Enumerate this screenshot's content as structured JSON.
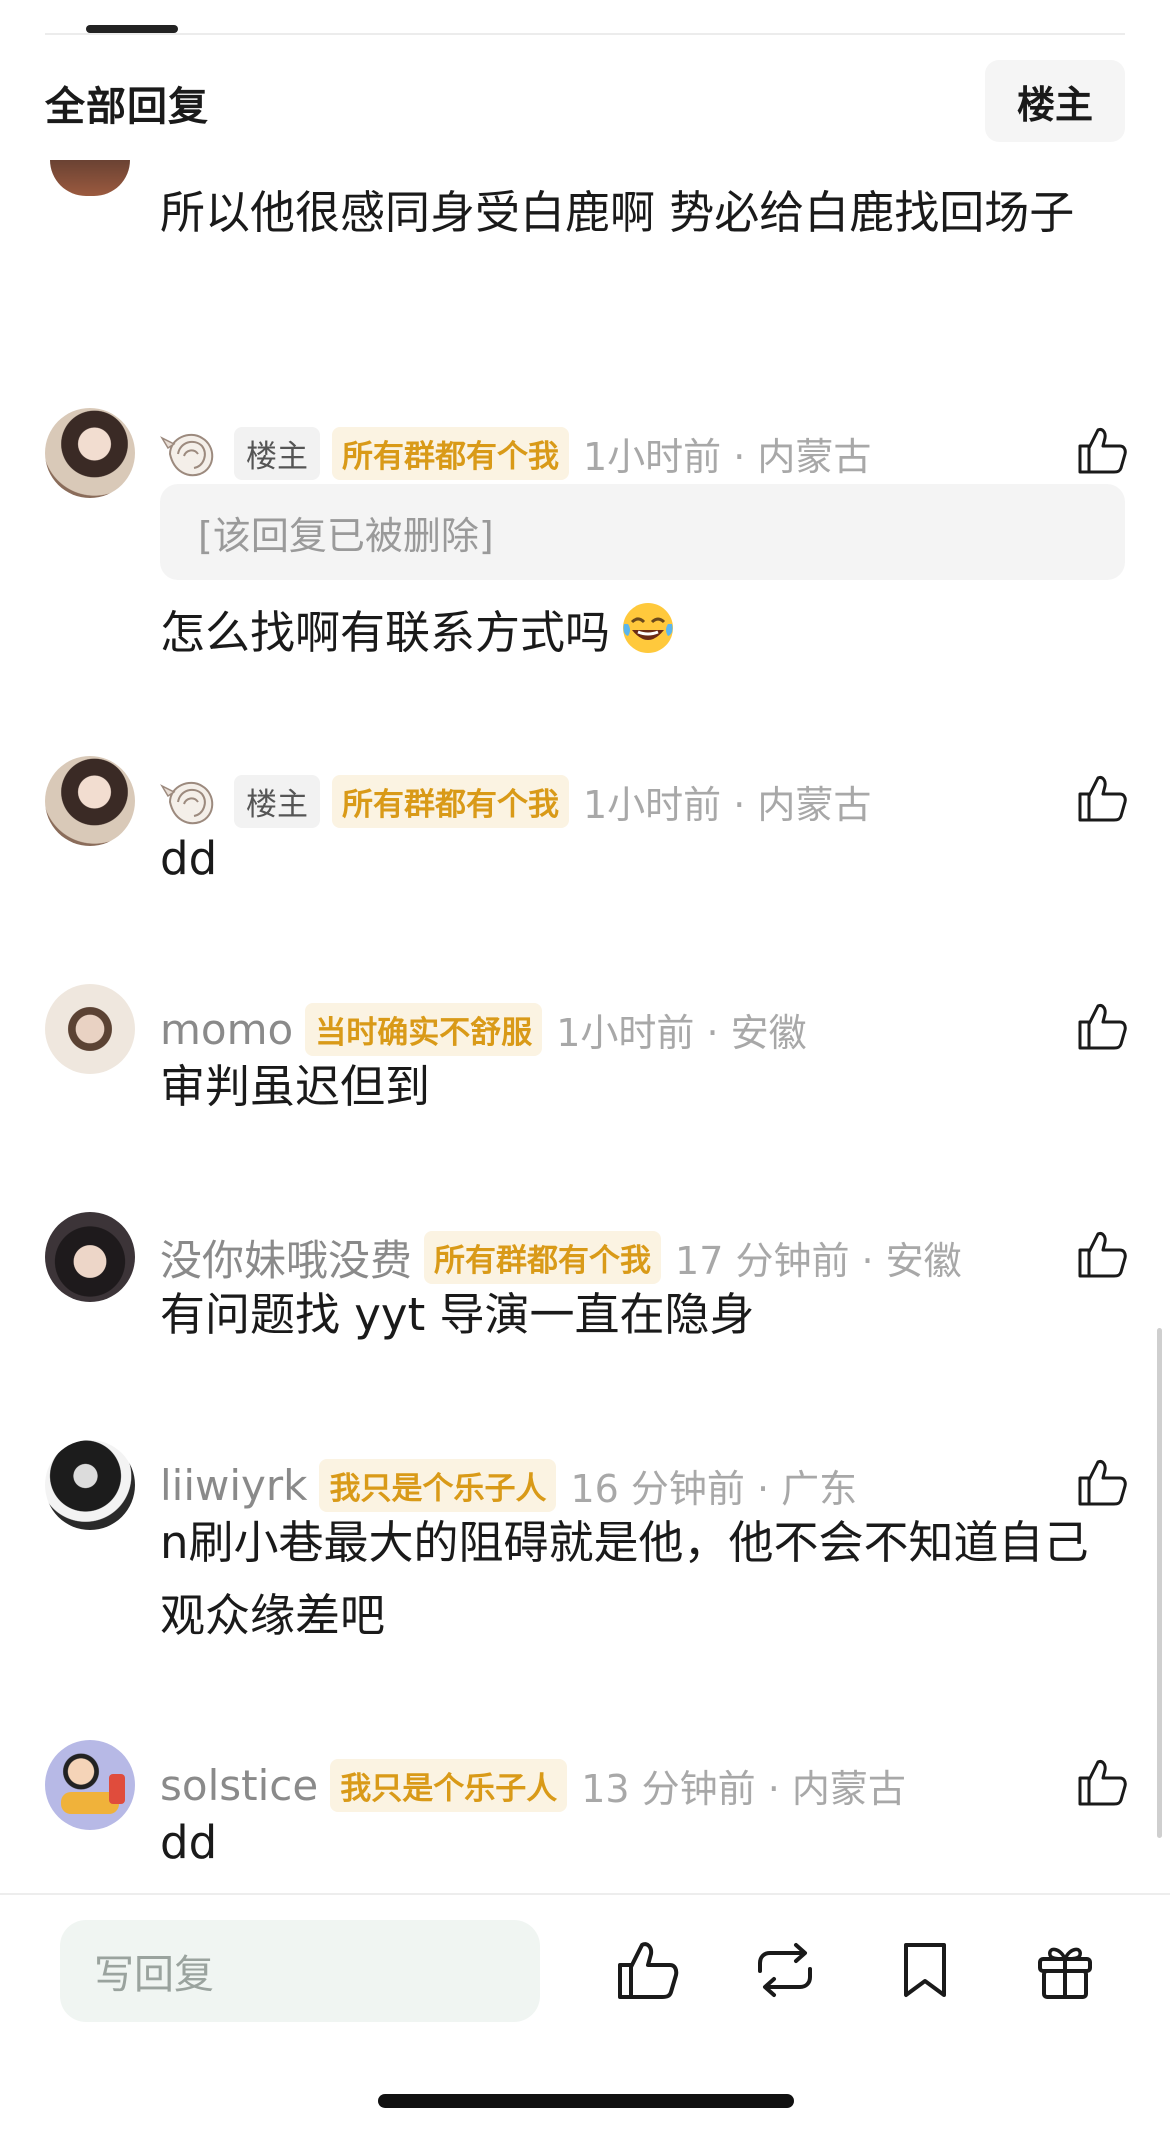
{
  "header": {
    "title": "全部回复",
    "poster_button": "楼主"
  },
  "top_comment_text": "所以他很感同身受白鹿啊 势必给白鹿找回场子",
  "comments": [
    {
      "username": "",
      "poster_tag": "楼主",
      "group_tag": "所有群都有个我",
      "time": "1小时前 · 内蒙古",
      "deleted_reply": "[该回复已被删除]",
      "text": "怎么找啊有联系方式吗"
    },
    {
      "username": "",
      "poster_tag": "楼主",
      "group_tag": "所有群都有个我",
      "time": "1小时前 · 内蒙古",
      "text": "dd"
    },
    {
      "username": "momo",
      "group_tag": "当时确实不舒服",
      "time": "1小时前 · 安徽",
      "text": "审判虽迟但到"
    },
    {
      "username": "没你妹哦没费",
      "group_tag": "所有群都有个我",
      "time": "17 分钟前 · 安徽",
      "text": "有问题找 yyt 导演一直在隐身"
    },
    {
      "username": "liiwiyrk",
      "group_tag": "我只是个乐子人",
      "time": "16 分钟前 · 广东",
      "text": "n刷小巷最大的阻碍就是他，他不会不知道自己观众缘差吧"
    },
    {
      "username": "solstice",
      "group_tag": "我只是个乐子人",
      "time": "13 分钟前 · 内蒙古",
      "text": "dd"
    }
  ],
  "bottom_bar": {
    "reply_placeholder": "写回复"
  },
  "icons": [
    "thumbs-up-icon",
    "shell-icon",
    "laugh-cry-emoji-icon",
    "repost-icon",
    "bookmark-icon",
    "gift-icon"
  ],
  "colors": {
    "group_tag_text": "#d99a18",
    "group_tag_bg": "#fbf3e2",
    "meta_gray": "#a8a8a8",
    "reply_input_bg": "#f0f5f2"
  }
}
